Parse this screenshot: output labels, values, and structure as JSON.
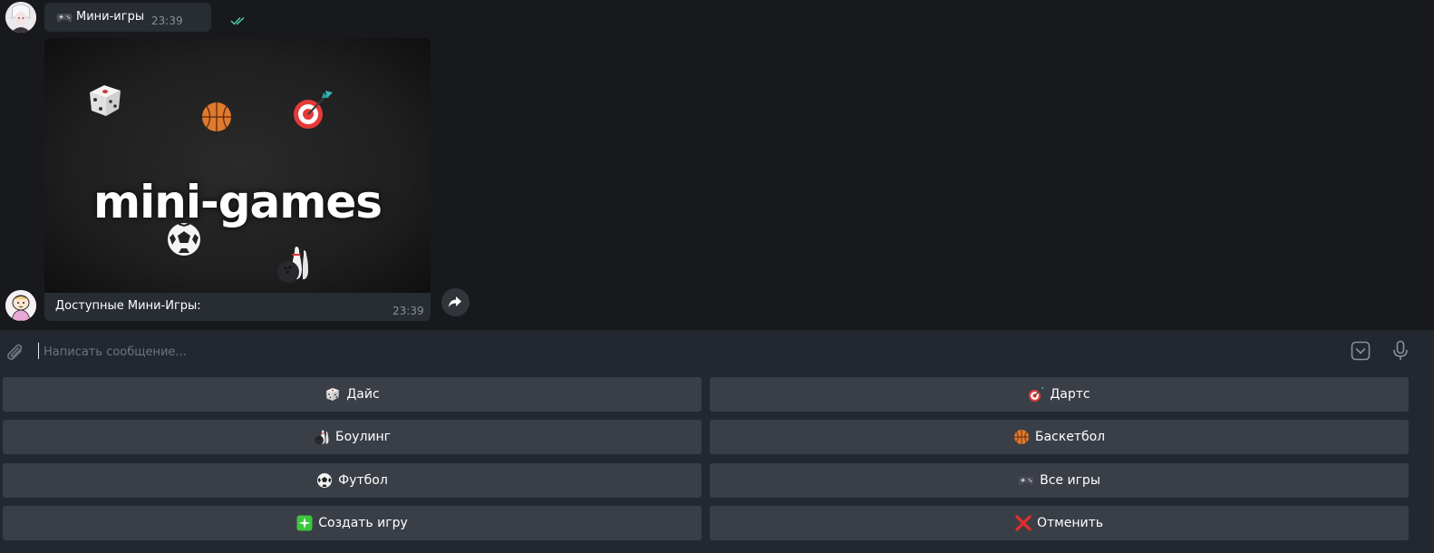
{
  "messages": {
    "first": {
      "text": "Мини-игры",
      "time": "23:39"
    },
    "media": {
      "image_title": "mini-games",
      "caption": "Доступные Мини-Игры:",
      "time": "23:39"
    }
  },
  "composer": {
    "placeholder": "Написать сообщение..."
  },
  "keyboard": {
    "buttons": [
      {
        "label": "Дайс",
        "icon": "dice-icon"
      },
      {
        "label": "Дартс",
        "icon": "dart-icon"
      },
      {
        "label": "Боулинг",
        "icon": "bowling-icon"
      },
      {
        "label": "Баскетбол",
        "icon": "basketball-icon"
      },
      {
        "label": "Футбол",
        "icon": "soccer-ball-icon"
      },
      {
        "label": "Все игры",
        "icon": "gamepad-icon"
      },
      {
        "label": "Создать игру",
        "icon": "sparkle-icon"
      },
      {
        "label": "Отменить",
        "icon": "cross-mark-icon"
      }
    ]
  },
  "colors": {
    "chat_background": "#17191d",
    "bubble": "#282c33",
    "button": "#3a3f47",
    "read_check": "#4fd1a8"
  }
}
